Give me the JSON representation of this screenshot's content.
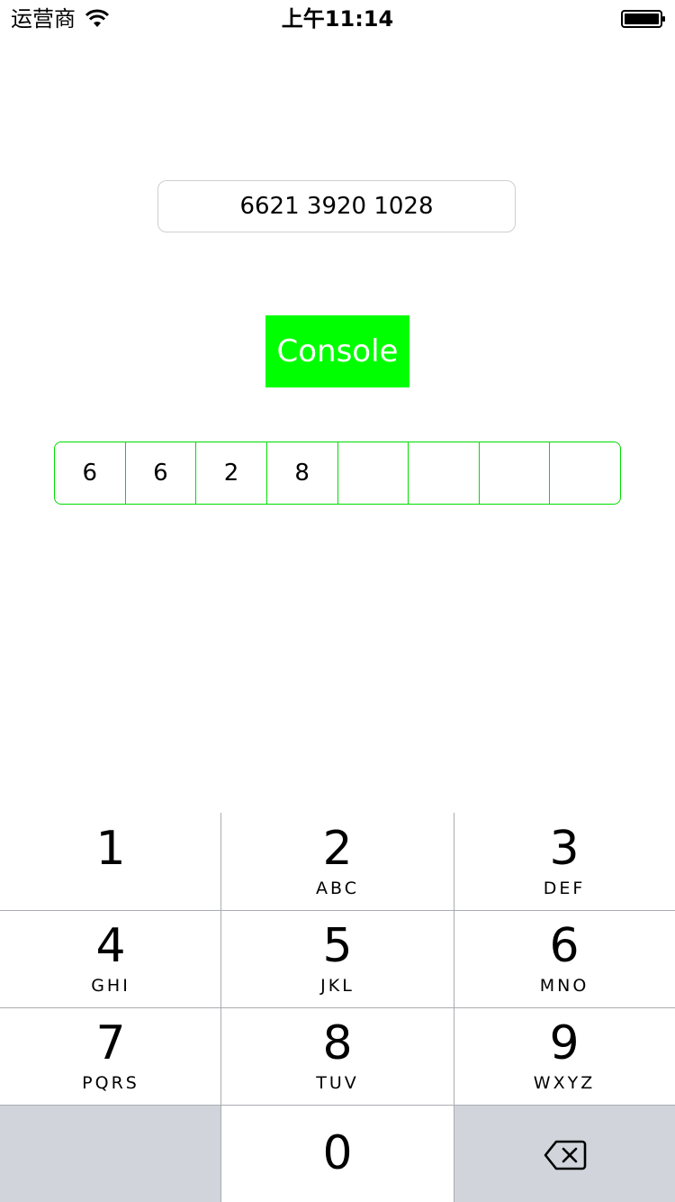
{
  "status_bar": {
    "carrier": "运营商",
    "time": "上午11:14"
  },
  "main": {
    "number_field_value": "6621 3920 1028",
    "console_button_label": "Console",
    "console_button_color": "#00ff00",
    "digit_boxes": [
      "6",
      "6",
      "2",
      "8",
      "",
      "",
      "",
      ""
    ],
    "digit_box_border_color": "#00dd00"
  },
  "keypad": {
    "keys": [
      {
        "num": "1",
        "letters": ""
      },
      {
        "num": "2",
        "letters": "ABC"
      },
      {
        "num": "3",
        "letters": "DEF"
      },
      {
        "num": "4",
        "letters": "GHI"
      },
      {
        "num": "5",
        "letters": "JKL"
      },
      {
        "num": "6",
        "letters": "MNO"
      },
      {
        "num": "7",
        "letters": "PQRS"
      },
      {
        "num": "8",
        "letters": "TUV"
      },
      {
        "num": "9",
        "letters": "WXYZ"
      },
      {
        "num": "0",
        "letters": ""
      }
    ],
    "delete_icon": "backspace-icon"
  }
}
